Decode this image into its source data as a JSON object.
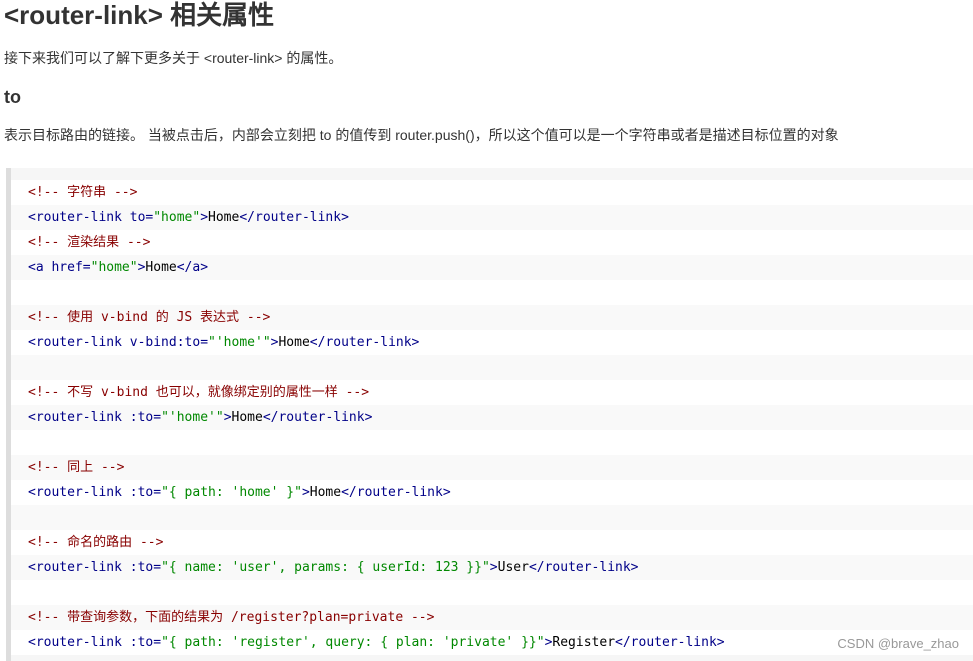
{
  "heading": "<router-link> 相关属性",
  "intro": "接下来我们可以了解下更多关于 <router-link> 的属性。",
  "section_title": "to",
  "description": "表示目标路由的链接。 当被点击后，内部会立刻把 to 的值传到 router.push()，所以这个值可以是一个字符串或者是描述目标位置的对象",
  "code_lines": [
    [
      {
        "t": "comment",
        "v": "<!-- 字符串 -->"
      }
    ],
    [
      {
        "t": "tag",
        "v": "<router-link "
      },
      {
        "t": "attr",
        "v": "to="
      },
      {
        "t": "str",
        "v": "\"home\""
      },
      {
        "t": "tag",
        "v": ">"
      },
      {
        "t": "text",
        "v": "Home"
      },
      {
        "t": "tag",
        "v": "</router-link>"
      }
    ],
    [
      {
        "t": "comment",
        "v": "<!-- 渲染结果 -->"
      }
    ],
    [
      {
        "t": "tag",
        "v": "<a "
      },
      {
        "t": "attr",
        "v": "href="
      },
      {
        "t": "str",
        "v": "\"home\""
      },
      {
        "t": "tag",
        "v": ">"
      },
      {
        "t": "text",
        "v": "Home"
      },
      {
        "t": "tag",
        "v": "</a>"
      }
    ],
    [],
    [
      {
        "t": "comment",
        "v": "<!-- 使用 v-bind 的 JS 表达式 -->"
      }
    ],
    [
      {
        "t": "tag",
        "v": "<router-link "
      },
      {
        "t": "attr",
        "v": "v-bind:to="
      },
      {
        "t": "str",
        "v": "\"'home'\""
      },
      {
        "t": "tag",
        "v": ">"
      },
      {
        "t": "text",
        "v": "Home"
      },
      {
        "t": "tag",
        "v": "</router-link>"
      }
    ],
    [],
    [
      {
        "t": "comment",
        "v": "<!-- 不写 v-bind 也可以，就像绑定别的属性一样 -->"
      }
    ],
    [
      {
        "t": "tag",
        "v": "<router-link "
      },
      {
        "t": "attr",
        "v": ":to="
      },
      {
        "t": "str",
        "v": "\"'home'\""
      },
      {
        "t": "tag",
        "v": ">"
      },
      {
        "t": "text",
        "v": "Home"
      },
      {
        "t": "tag",
        "v": "</router-link>"
      }
    ],
    [],
    [
      {
        "t": "comment",
        "v": "<!-- 同上 -->"
      }
    ],
    [
      {
        "t": "tag",
        "v": "<router-link "
      },
      {
        "t": "attr",
        "v": ":to="
      },
      {
        "t": "str",
        "v": "\"{ path: 'home' }\""
      },
      {
        "t": "tag",
        "v": ">"
      },
      {
        "t": "text",
        "v": "Home"
      },
      {
        "t": "tag",
        "v": "</router-link>"
      }
    ],
    [],
    [
      {
        "t": "comment",
        "v": "<!-- 命名的路由 -->"
      }
    ],
    [
      {
        "t": "tag",
        "v": "<router-link "
      },
      {
        "t": "attr",
        "v": ":to="
      },
      {
        "t": "str",
        "v": "\"{ name: 'user', params: { userId: 123 }}\""
      },
      {
        "t": "tag",
        "v": ">"
      },
      {
        "t": "text",
        "v": "User"
      },
      {
        "t": "tag",
        "v": "</router-link>"
      }
    ],
    [],
    [
      {
        "t": "comment",
        "v": "<!-- 带查询参数，下面的结果为 /register?plan=private -->"
      }
    ],
    [
      {
        "t": "tag",
        "v": "<router-link "
      },
      {
        "t": "attr",
        "v": ":to="
      },
      {
        "t": "str",
        "v": "\"{ path: 'register', query: { plan: 'private' }}\""
      },
      {
        "t": "tag",
        "v": ">"
      },
      {
        "t": "text",
        "v": "Register"
      },
      {
        "t": "tag",
        "v": "</router-link>"
      }
    ]
  ],
  "watermark": "CSDN @brave_zhao",
  "colors": {
    "comment": "#880000",
    "tag": "#000088",
    "string": "#008800",
    "text": "#000000",
    "code_bg": "#f6f6f6",
    "code_border": "#dddddd"
  }
}
